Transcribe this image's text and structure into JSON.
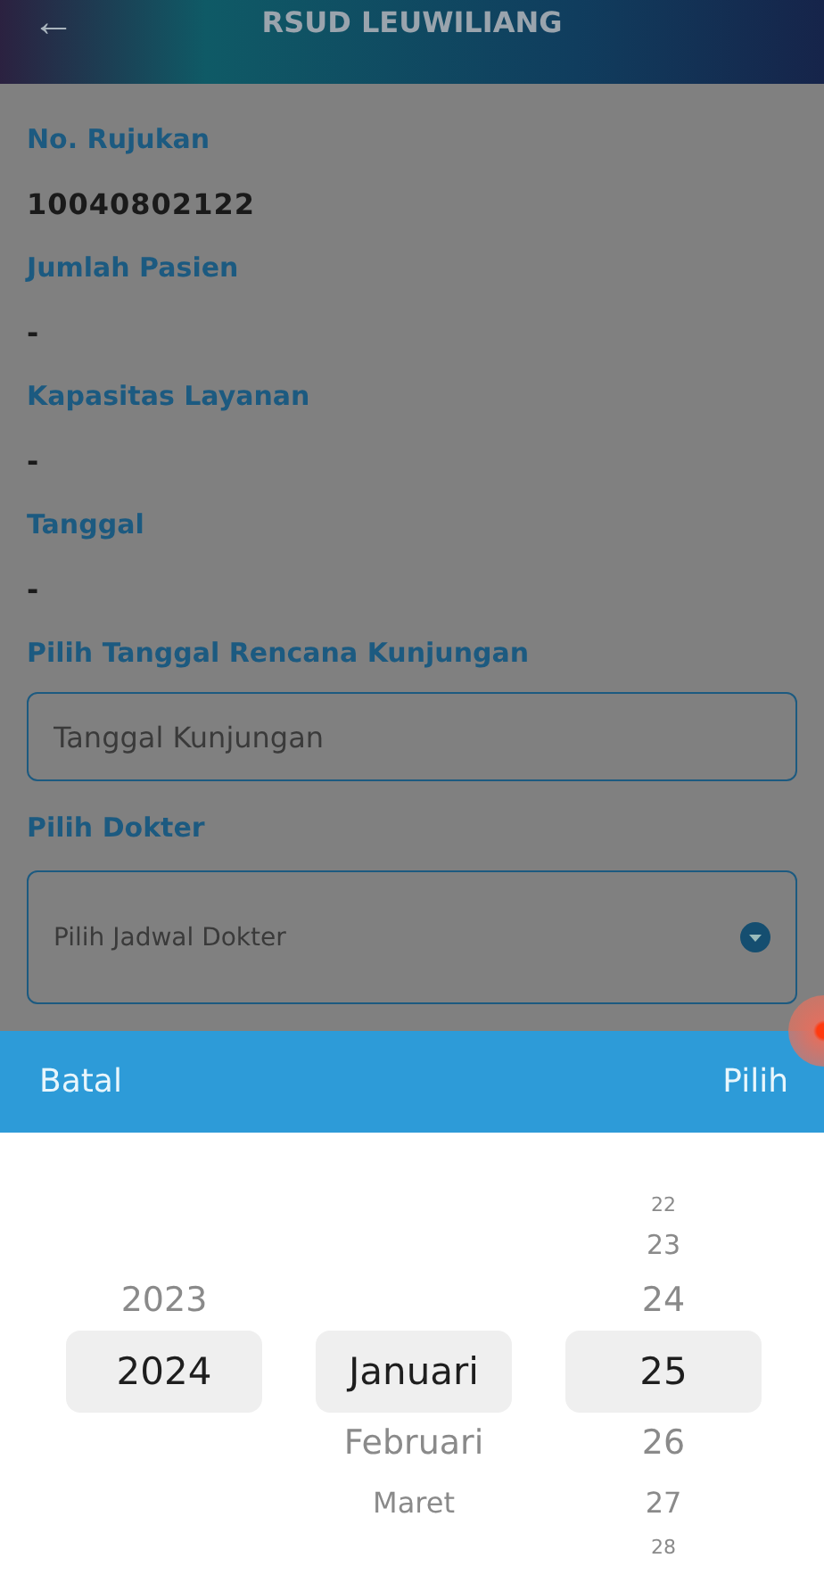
{
  "header": {
    "back_icon": "←",
    "title": "RSUD LEUWILIANG"
  },
  "fields": [
    {
      "label": "No. Rujukan",
      "value": "10040802122",
      "kind": "text"
    },
    {
      "label": "Jumlah Pasien",
      "value": "-",
      "kind": "text"
    },
    {
      "label": "Kapasitas Layanan",
      "value": "-",
      "kind": "text"
    },
    {
      "label": "Tanggal",
      "value": "-",
      "kind": "text"
    },
    {
      "label": "Pilih Tanggal Rencana Kunjungan",
      "placeholder": "Tanggal Kunjungan",
      "kind": "input"
    },
    {
      "label": "Pilih Dokter",
      "placeholder": "Pilih Jadwal Dokter",
      "kind": "select"
    }
  ],
  "picker": {
    "cancel": "Batal",
    "confirm": "Pilih",
    "columns": [
      [
        {
          "label": "2023",
          "selected": false
        },
        {
          "label": "2024",
          "selected": true
        }
      ],
      [
        {
          "label": "Januari",
          "selected": true
        },
        {
          "label": "Februari",
          "selected": false
        },
        {
          "label": "Maret",
          "selected": false
        }
      ],
      [
        {
          "label": "22",
          "selected": false
        },
        {
          "label": "23",
          "selected": false
        },
        {
          "label": "24",
          "selected": false
        },
        {
          "label": "25",
          "selected": true
        },
        {
          "label": "26",
          "selected": false
        },
        {
          "label": "27",
          "selected": false
        },
        {
          "label": "28",
          "selected": false
        }
      ]
    ]
  }
}
